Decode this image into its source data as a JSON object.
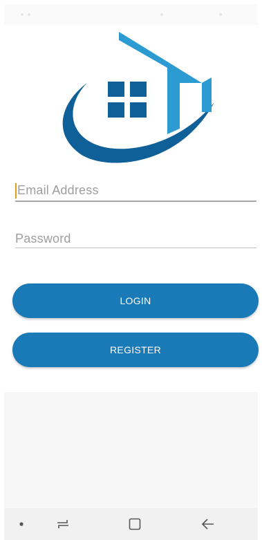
{
  "brand": {
    "primary_blue": "#1a7ab7",
    "logo_dark_blue": "#0f5f99",
    "logo_light_blue": "#2b9bd1",
    "cursor_color": "#e3a016"
  },
  "logo": {
    "icon": "house-logo-icon"
  },
  "form": {
    "email_placeholder": "Email Address",
    "password_placeholder": "Password"
  },
  "buttons": {
    "login_label": "LOGIN",
    "register_label": "REGISTER"
  },
  "nav": {
    "items": [
      {
        "icon": "dot-icon"
      },
      {
        "icon": "recent-apps-icon"
      },
      {
        "icon": "home-icon"
      },
      {
        "icon": "back-icon"
      }
    ]
  }
}
